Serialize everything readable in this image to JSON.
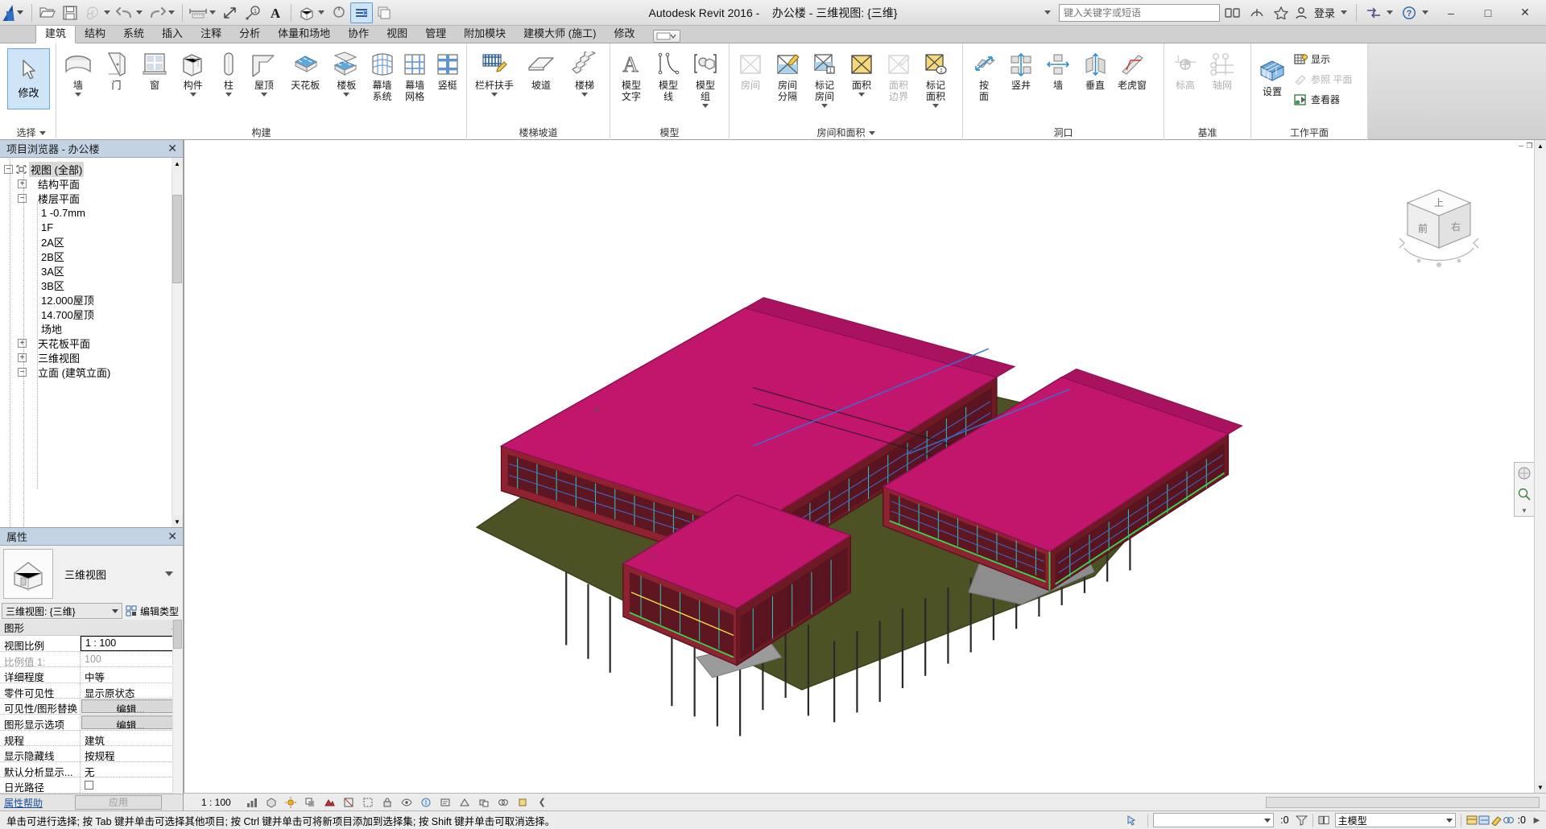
{
  "titlebar": {
    "app_title": "Autodesk Revit 2016 -",
    "document_title": "办公楼 - 三维视图: {三维}",
    "search_placeholder": "键入关键字或短语",
    "signin_label": "登录",
    "quick_access_icons": [
      "open-icon",
      "save-icon",
      "sync-icon",
      "undo-icon",
      "redo-icon",
      "measure-icon",
      "aligned-dimension-icon",
      "tag-icon",
      "text-icon",
      "default-3d-view-icon",
      "section-icon",
      "thin-lines-icon",
      "close-hidden-icon"
    ],
    "window_buttons": [
      "minimize",
      "maximize",
      "close"
    ]
  },
  "ribbon": {
    "tabs": [
      {
        "label": "建筑",
        "active": true
      },
      {
        "label": "结构",
        "active": false
      },
      {
        "label": "系统",
        "active": false
      },
      {
        "label": "插入",
        "active": false
      },
      {
        "label": "注释",
        "active": false
      },
      {
        "label": "分析",
        "active": false
      },
      {
        "label": "体量和场地",
        "active": false
      },
      {
        "label": "协作",
        "active": false
      },
      {
        "label": "视图",
        "active": false
      },
      {
        "label": "管理",
        "active": false
      },
      {
        "label": "附加模块",
        "active": false
      },
      {
        "label": "建模大师 (施工)",
        "active": false
      },
      {
        "label": "修改",
        "active": false
      }
    ],
    "panels": [
      {
        "caption": "选择",
        "caption_has_dropdown": true,
        "modify_button": {
          "label": "修改",
          "icon": "cursor-arrow-icon"
        }
      },
      {
        "caption": "构建",
        "caption_has_dropdown": false,
        "buttons": [
          {
            "label": "墙",
            "icon": "wall-icon",
            "dropdown": true,
            "disabled": false
          },
          {
            "label": "门",
            "icon": "door-icon",
            "dropdown": false,
            "disabled": false
          },
          {
            "label": "窗",
            "icon": "window-icon",
            "dropdown": false,
            "disabled": false
          },
          {
            "label": "构件",
            "icon": "component-icon",
            "dropdown": true,
            "disabled": false
          },
          {
            "label": "柱",
            "icon": "column-icon",
            "dropdown": true,
            "disabled": false
          },
          {
            "label": "屋顶",
            "icon": "roof-icon",
            "dropdown": true,
            "disabled": false
          },
          {
            "label": "天花板",
            "icon": "ceiling-icon",
            "dropdown": false,
            "disabled": false
          },
          {
            "label": "楼板",
            "icon": "floor-icon",
            "dropdown": true,
            "disabled": false
          },
          {
            "label": "幕墙\n系统",
            "icon": "curtain-system-icon",
            "dropdown": false,
            "disabled": false
          },
          {
            "label": "幕墙\n网格",
            "icon": "curtain-grid-icon",
            "dropdown": false,
            "disabled": false
          },
          {
            "label": "竖梃",
            "icon": "mullion-icon",
            "dropdown": false,
            "disabled": false
          }
        ]
      },
      {
        "caption": "楼梯坡道",
        "caption_has_dropdown": false,
        "buttons": [
          {
            "label": "栏杆扶手",
            "icon": "railing-icon",
            "dropdown": true,
            "disabled": false
          },
          {
            "label": "坡道",
            "icon": "ramp-icon",
            "dropdown": false,
            "disabled": false
          },
          {
            "label": "楼梯",
            "icon": "stair-icon",
            "dropdown": true,
            "disabled": false
          }
        ]
      },
      {
        "caption": "模型",
        "caption_has_dropdown": false,
        "buttons": [
          {
            "label": "模型\n文字",
            "icon": "model-text-icon",
            "dropdown": false,
            "disabled": false
          },
          {
            "label": "模型\n线",
            "icon": "model-line-icon",
            "dropdown": false,
            "disabled": false
          },
          {
            "label": "模型\n组",
            "icon": "model-group-icon",
            "dropdown": true,
            "disabled": false
          }
        ]
      },
      {
        "caption": "房间和面积",
        "caption_has_dropdown": true,
        "buttons": [
          {
            "label": "房间",
            "icon": "room-icon",
            "dropdown": false,
            "disabled": true
          },
          {
            "label": "房间\n分隔",
            "icon": "room-separator-icon",
            "dropdown": false,
            "disabled": false
          },
          {
            "label": "标记\n房间",
            "icon": "tag-room-icon",
            "dropdown": true,
            "disabled": false
          },
          {
            "label": "面积",
            "icon": "area-icon",
            "dropdown": true,
            "disabled": false
          },
          {
            "label": "面积\n边界",
            "icon": "area-boundary-icon",
            "dropdown": false,
            "disabled": true
          },
          {
            "label": "标记\n面积",
            "icon": "tag-area-icon",
            "dropdown": true,
            "disabled": false
          }
        ]
      },
      {
        "caption": "洞口",
        "caption_has_dropdown": false,
        "buttons": [
          {
            "label": "按\n面",
            "icon": "opening-by-face-icon",
            "dropdown": false,
            "disabled": false
          },
          {
            "label": "竖井",
            "icon": "shaft-opening-icon",
            "dropdown": false,
            "disabled": false
          },
          {
            "label": "墙",
            "icon": "wall-opening-icon",
            "dropdown": false,
            "disabled": false
          },
          {
            "label": "垂直",
            "icon": "vertical-opening-icon",
            "dropdown": false,
            "disabled": false
          },
          {
            "label": "老虎窗",
            "icon": "dormer-opening-icon",
            "dropdown": false,
            "disabled": false
          }
        ]
      },
      {
        "caption": "基准",
        "caption_has_dropdown": false,
        "buttons": [
          {
            "label": "标高",
            "icon": "level-icon",
            "dropdown": false,
            "disabled": true
          },
          {
            "label": "轴网",
            "icon": "grid-icon",
            "dropdown": false,
            "disabled": true
          }
        ]
      },
      {
        "caption": "工作平面",
        "caption_has_dropdown": false,
        "buttons": [
          {
            "label": "设置",
            "icon": "workplane-set-icon",
            "dropdown": false,
            "disabled": false
          }
        ],
        "small_buttons": [
          {
            "label": "显示",
            "icon": "workplane-show-icon",
            "disabled": false
          },
          {
            "label": "参照 平面",
            "icon": "reference-plane-icon",
            "disabled": true
          },
          {
            "label": "查看器",
            "icon": "workplane-viewer-icon",
            "disabled": false
          }
        ]
      }
    ]
  },
  "project_browser": {
    "title": "项目浏览器 - 办公楼",
    "close_icon": "close-icon",
    "nodes": [
      {
        "depth": 0,
        "label": "视图 (全部)",
        "expander": "-",
        "icon": "views-icon",
        "selected": true
      },
      {
        "depth": 1,
        "label": "结构平面",
        "expander": "+",
        "selected": false
      },
      {
        "depth": 1,
        "label": "楼层平面",
        "expander": "-",
        "selected": false
      },
      {
        "depth": 2,
        "label": "1 -0.7mm",
        "expander": "",
        "selected": false
      },
      {
        "depth": 2,
        "label": "1F",
        "expander": "",
        "selected": false
      },
      {
        "depth": 2,
        "label": "2A区",
        "expander": "",
        "selected": false
      },
      {
        "depth": 2,
        "label": "2B区",
        "expander": "",
        "selected": false
      },
      {
        "depth": 2,
        "label": "3A区",
        "expander": "",
        "selected": false
      },
      {
        "depth": 2,
        "label": "3B区",
        "expander": "",
        "selected": false
      },
      {
        "depth": 2,
        "label": "12.000屋顶",
        "expander": "",
        "selected": false
      },
      {
        "depth": 2,
        "label": "14.700屋顶",
        "expander": "",
        "selected": false
      },
      {
        "depth": 2,
        "label": "场地",
        "expander": "",
        "selected": false
      },
      {
        "depth": 1,
        "label": "天花板平面",
        "expander": "+",
        "selected": false
      },
      {
        "depth": 1,
        "label": "三维视图",
        "expander": "+",
        "selected": false
      },
      {
        "depth": 1,
        "label": "立面 (建筑立面)",
        "expander": "-",
        "selected": false
      }
    ]
  },
  "properties": {
    "title": "属性",
    "close_icon": "close-icon",
    "type_thumbnail_icon": "house-3d-icon",
    "type_name": "三维视图",
    "type_selector_value": "三维视图: {三维}",
    "edit_type_label": "编辑类型",
    "edit_type_icon": "edit-type-icon",
    "group_header": "图形",
    "group_collapse_icon": "chevron-up-icon",
    "rows": [
      {
        "key": "视图比例",
        "value": "1 : 100",
        "style": "boxed"
      },
      {
        "key": "比例值 1:",
        "value": "100",
        "style": "dim"
      },
      {
        "key": "详细程度",
        "value": "中等",
        "style": "normal"
      },
      {
        "key": "零件可见性",
        "value": "显示原状态",
        "style": "normal"
      },
      {
        "key": "可见性/图形替换",
        "value": "编辑...",
        "style": "button"
      },
      {
        "key": "图形显示选项",
        "value": "编辑...",
        "style": "button"
      },
      {
        "key": "规程",
        "value": "建筑",
        "style": "normal"
      },
      {
        "key": "显示隐藏线",
        "value": "按规程",
        "style": "normal"
      },
      {
        "key": "默认分析显示...",
        "value": "无",
        "style": "normal"
      },
      {
        "key": "日光路径",
        "value": "",
        "style": "checkbox"
      }
    ],
    "footer_help": "属性帮助",
    "footer_apply": "应用"
  },
  "view": {
    "model_name": "办公楼",
    "navcube_faces": [
      "上",
      "前",
      "右"
    ],
    "window_controls": [
      "minimize",
      "restore",
      "close"
    ]
  },
  "view_control_bar": {
    "scale": "1 : 100",
    "icons": [
      "detail-level-icon",
      "visual-style-icon",
      "sun-path-icon",
      "shadows-icon",
      "rendering-dialog-icon",
      "crop-view-icon",
      "show-crop-icon",
      "lock-3d-view-icon",
      "temporary-hide-isolate-icon",
      "reveal-hidden-icon",
      "temporary-view-properties-icon",
      "show-analytical-model-icon",
      "highlight-displacement-icon",
      "worksharing-display-icon",
      "constraints-icon",
      "expand-icon"
    ]
  },
  "status_bar": {
    "message": "单击可进行选择; 按 Tab 键并单击可选择其他项目; 按 Ctrl 键并单击可将新项目添加到选择集; 按 Shift 键并单击可取消选择。",
    "press_pick_icon": "press-drag-icon",
    "selection_count": ":0",
    "filter_icon": "filter-icon",
    "worksets_icon": "worksets-icon",
    "workset_value": "主模型",
    "right_icons": [
      "design-options-icon",
      "exclude-options-icon",
      "editable-only-icon",
      "worksharing-icon"
    ],
    "right_count": ":0"
  }
}
